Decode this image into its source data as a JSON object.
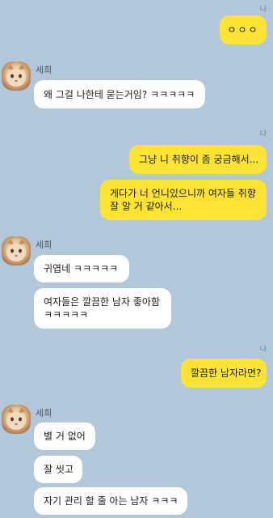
{
  "me_label": "나",
  "other_name": "세희",
  "messages": {
    "m1": "ㅇㅇㅇ",
    "o1": "왜 그걸 나한테 묻는거임? ㅋㅋㅋㅋㅋ",
    "m2": "그냥 니 취향이 좀 궁금해서...",
    "m3": "게다가 너 언니있으니까 여자들 취향\n잘 알 거 같아서...",
    "o2": "귀엽네 ㅋㅋㅋㅋㅋ",
    "o3": "여자들은 깔끔한 남자 좋아함\nㅋㅋㅋㅋㅋ",
    "m4": "깔끔한 남자라면?",
    "o4": "별 거 없어",
    "o5": "잘 씻고",
    "o6": "자기 관리 할 줄 아는 남자 ㅋㅋㅋ"
  },
  "colors": {
    "background": "#b2c7d9",
    "my_bubble": "#fde332",
    "other_bubble": "#ffffff"
  }
}
